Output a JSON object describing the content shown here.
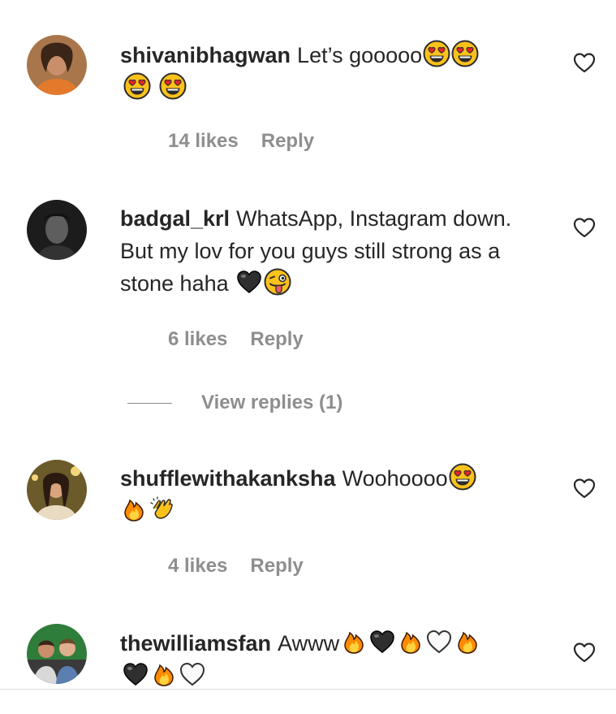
{
  "comments": [
    {
      "username": "shivanibhagwan",
      "text": "Let’s gooooo",
      "likes": "14 likes",
      "reply": "Reply",
      "emoji": [
        "heart-eyes",
        "heart-eyes",
        "heart-eyes",
        "heart-eyes"
      ]
    },
    {
      "username": "badgal_krl",
      "text": "WhatsApp, Instagram down. But my lov for you guys still strong as a stone haha",
      "likes": "6 likes",
      "reply": "Reply",
      "view_replies": "View replies (1)",
      "emoji": [
        "black-heart",
        "winking-tongue"
      ]
    },
    {
      "username": "shufflewithakanksha",
      "text": "Woohoooo",
      "likes": "4 likes",
      "reply": "Reply",
      "emoji": [
        "heart-eyes",
        "fire",
        "clapping-hands"
      ]
    },
    {
      "username": "thewilliamsfan",
      "text": "Awww",
      "emoji": [
        "fire",
        "black-heart",
        "fire",
        "white-heart",
        "fire",
        "black-heart",
        "fire",
        "white-heart"
      ]
    }
  ],
  "colors": {
    "text": "#262626",
    "meta": "#8e8e8e",
    "emoji_yellow": "#fcc21b",
    "emoji_heart": "#e5252a",
    "fire": "#ff8a00"
  }
}
